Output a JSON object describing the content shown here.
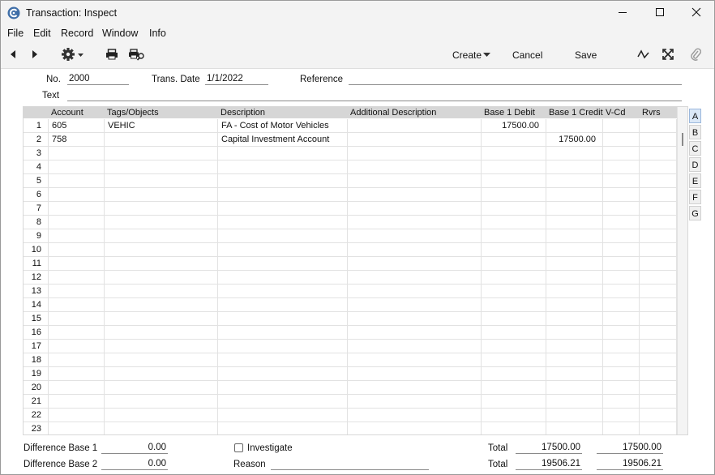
{
  "window": {
    "title": "Transaction: Inspect"
  },
  "menu": [
    "File",
    "Edit",
    "Record",
    "Window",
    "Info"
  ],
  "toolbar": {
    "create_label": "Create",
    "cancel_label": "Cancel",
    "save_label": "Save"
  },
  "header": {
    "no_label": "No.",
    "no_value": "2000",
    "date_label": "Trans. Date",
    "date_value": "1/1/2022",
    "reference_label": "Reference",
    "reference_value": "",
    "text_label": "Text",
    "text_value": ""
  },
  "grid": {
    "columns": [
      "",
      "Account",
      "Tags/Objects",
      "Description",
      "Additional Description",
      "Base 1 Debit",
      "Base 1 Credit",
      "V-Cd",
      "Rvrs"
    ],
    "rows": [
      {
        "n": "1",
        "account": "605",
        "tags": "VEHIC",
        "desc": "FA - Cost of Motor Vehicles",
        "adesc": "",
        "debit": "17500.00",
        "credit": "",
        "vcd": "",
        "rvrs": ""
      },
      {
        "n": "2",
        "account": "758",
        "tags": "",
        "desc": "Capital Investment Account",
        "adesc": "",
        "debit": "",
        "credit": "17500.00",
        "vcd": "",
        "rvrs": ""
      },
      {
        "n": "3"
      },
      {
        "n": "4"
      },
      {
        "n": "5"
      },
      {
        "n": "6"
      },
      {
        "n": "7"
      },
      {
        "n": "8"
      },
      {
        "n": "9"
      },
      {
        "n": "10"
      },
      {
        "n": "11"
      },
      {
        "n": "12"
      },
      {
        "n": "13"
      },
      {
        "n": "14"
      },
      {
        "n": "15"
      },
      {
        "n": "16"
      },
      {
        "n": "17"
      },
      {
        "n": "18"
      },
      {
        "n": "19"
      },
      {
        "n": "20"
      },
      {
        "n": "21"
      },
      {
        "n": "22"
      },
      {
        "n": "23"
      }
    ]
  },
  "tabs": [
    "A",
    "B",
    "C",
    "D",
    "E",
    "F",
    "G"
  ],
  "footer": {
    "diff1_label": "Difference Base 1",
    "diff1_value": "0.00",
    "diff2_label": "Difference Base 2",
    "diff2_value": "0.00",
    "investigate_label": "Investigate",
    "reason_label": "Reason",
    "reason_value": "",
    "total1_label": "Total",
    "total1_debit": "17500.00",
    "total1_credit": "17500.00",
    "total2_label": "Total",
    "total2_debit": "19506.21",
    "total2_credit": "19506.21"
  },
  "icons": {
    "app": "app-logo-icon",
    "minimize": "minimize-icon",
    "maximize": "maximize-icon",
    "close": "close-icon",
    "prev": "arrow-left-icon",
    "next": "arrow-right-icon",
    "settings": "gear-icon",
    "print": "printer-icon",
    "preview": "print-preview-icon",
    "create_menu": "chevron-down-icon",
    "activity": "activity-icon",
    "expand": "expand-icon",
    "attach": "paperclip-icon"
  }
}
